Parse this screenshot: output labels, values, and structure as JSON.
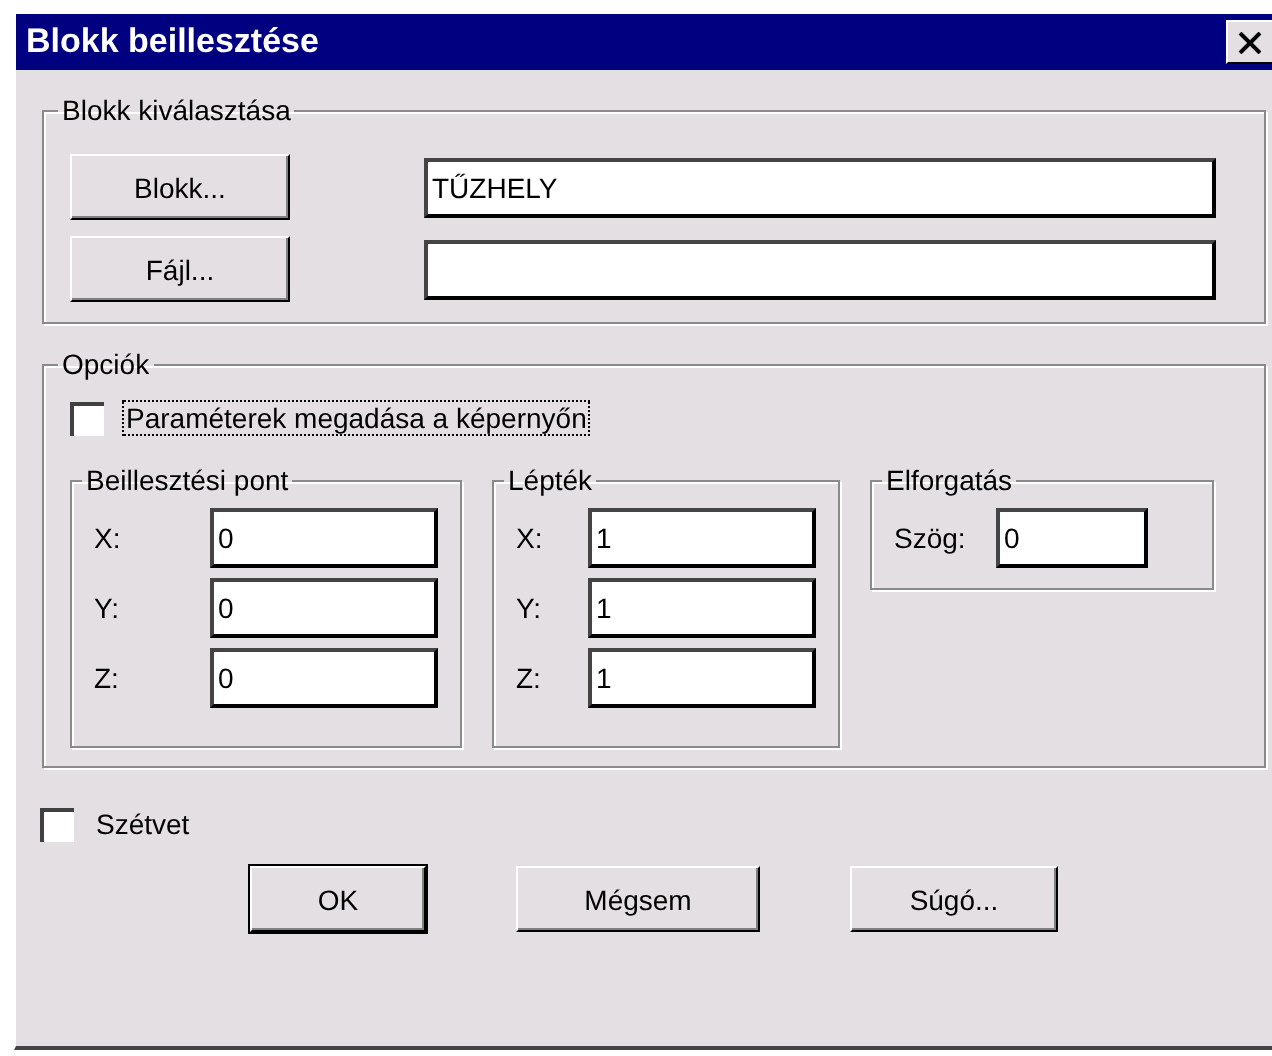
{
  "window": {
    "title": "Blokk beillesztése"
  },
  "block_selection": {
    "title": "Blokk kiválasztása",
    "rows": [
      {
        "button": "Blokk...",
        "value": "TŰZHELY"
      },
      {
        "button": "Fájl..."
      }
    ]
  },
  "options": {
    "title": "Opciók",
    "on_screen": {
      "label": "Paraméterek megadása a képernyőn",
      "checked": false,
      "focused": true
    },
    "groups": [
      {
        "title": "Beillesztési pont",
        "fields": [
          {
            "label": "X:",
            "value": "0"
          },
          {
            "label": "Y:",
            "value": "0"
          },
          {
            "label": "Z:",
            "value": "0"
          }
        ]
      },
      {
        "title": "Lépték",
        "fields": [
          {
            "label": "X:",
            "value": "1"
          },
          {
            "label": "Y:",
            "value": "1"
          },
          {
            "label": "Z:",
            "value": "1"
          }
        ]
      },
      {
        "title": "Elforgatás",
        "fields": [
          {
            "label": "Szög:",
            "value": "0"
          }
        ]
      }
    ]
  },
  "explode": {
    "label": "Szétvet",
    "checked": false
  },
  "buttons": [
    {
      "label": "OK",
      "default": true
    },
    {
      "label": "Mégsem",
      "default": false
    },
    {
      "label": "Súgó...",
      "default": false
    }
  ]
}
